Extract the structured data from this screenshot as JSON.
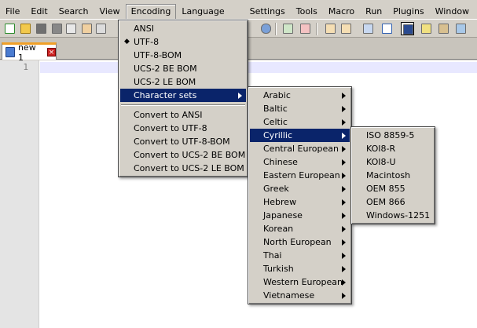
{
  "menubar": {
    "items": [
      "File",
      "Edit",
      "Search",
      "View",
      "Encoding",
      "Language",
      "Settings",
      "Tools",
      "Macro",
      "Run",
      "Plugins",
      "Window",
      "?"
    ]
  },
  "tab": {
    "label": "new 1",
    "close_glyph": "×"
  },
  "editor": {
    "line_number": "1"
  },
  "encoding_menu": {
    "items": [
      "ANSI",
      "UTF-8",
      "UTF-8-BOM",
      "UCS-2 BE BOM",
      "UCS-2 LE BOM",
      "Character sets"
    ],
    "checked_item": "UTF-8",
    "convert_items": [
      "Convert to ANSI",
      "Convert to UTF-8",
      "Convert to UTF-8-BOM",
      "Convert to UCS-2 BE BOM",
      "Convert to UCS-2 LE BOM"
    ]
  },
  "charsets_menu": {
    "items": [
      "Arabic",
      "Baltic",
      "Celtic",
      "Cyrillic",
      "Central European",
      "Chinese",
      "Eastern European",
      "Greek",
      "Hebrew",
      "Japanese",
      "Korean",
      "North European",
      "Thai",
      "Turkish",
      "Western European",
      "Vietnamese"
    ],
    "selected": "Cyrillic"
  },
  "cyrillic_menu": {
    "items": [
      "ISO 8859-5",
      "KOI8-R",
      "KOI8-U",
      "Macintosh",
      "OEM 855",
      "OEM 866",
      "Windows-1251"
    ]
  },
  "colors": {
    "menu_highlight": "#0a246a",
    "tab_accent": "#f0a028",
    "current_line": "#e8e8ff"
  }
}
